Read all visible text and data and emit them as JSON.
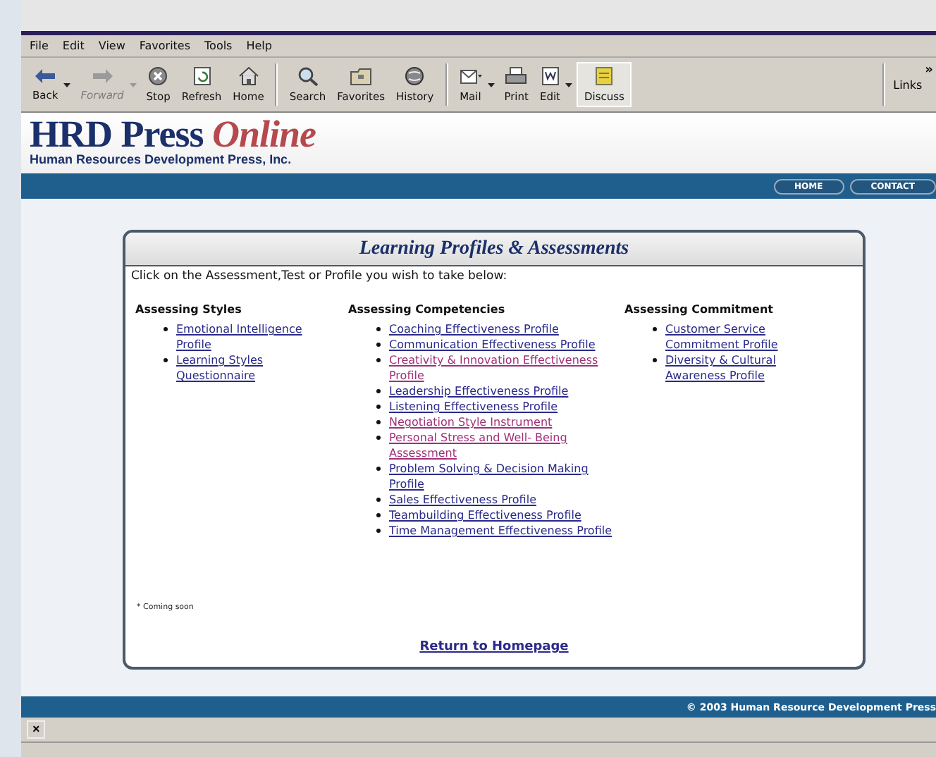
{
  "browser": {
    "menu": [
      "File",
      "Edit",
      "View",
      "Favorites",
      "Tools",
      "Help"
    ],
    "toolbar": [
      {
        "label": "Back",
        "kind": "back",
        "disabled": false,
        "dropdown": true
      },
      {
        "label": "Forward",
        "kind": "forward",
        "disabled": true,
        "dropdown": true
      },
      {
        "label": "Stop",
        "kind": "stop",
        "disabled": false,
        "dropdown": false
      },
      {
        "label": "Refresh",
        "kind": "refresh",
        "disabled": false,
        "dropdown": false
      },
      {
        "label": "Home",
        "kind": "home",
        "disabled": false,
        "dropdown": false
      },
      {
        "label": "Search",
        "kind": "search",
        "disabled": false,
        "dropdown": false
      },
      {
        "label": "Favorites",
        "kind": "folder",
        "disabled": false,
        "dropdown": false
      },
      {
        "label": "History",
        "kind": "history",
        "disabled": false,
        "dropdown": false
      },
      {
        "label": "Mail",
        "kind": "mail",
        "disabled": false,
        "dropdown": true
      },
      {
        "label": "Print",
        "kind": "print",
        "disabled": false,
        "dropdown": false
      },
      {
        "label": "Edit",
        "kind": "edit",
        "disabled": false,
        "dropdown": true
      },
      {
        "label": "Discuss",
        "kind": "discuss",
        "disabled": false,
        "dropdown": false
      }
    ],
    "links": "Links",
    "chevron": "»",
    "close": "×"
  },
  "site": {
    "logo_main": "HRD Press",
    "logo_accent": "Online",
    "tagline": "Human Resources Development Press, Inc.",
    "nav": [
      "HOME",
      "CONTACT"
    ]
  },
  "panel": {
    "title": "Learning Profiles & Assessments",
    "instruction": "Click on the Assessment,Test or Profile you wish to take below:",
    "columns": [
      {
        "heading": "Assessing Styles",
        "links": [
          {
            "text": "Emotional Intelligence Profile",
            "visited": false
          },
          {
            "text": "Learning Styles Questionnaire",
            "visited": false
          }
        ]
      },
      {
        "heading": "Assessing Competencies",
        "links": [
          {
            "text": "Coaching Effectiveness Profile",
            "visited": false
          },
          {
            "text": "Communication Effectiveness Profile",
            "visited": false
          },
          {
            "text": "Creativity & Innovation Effectiveness Profile",
            "visited": true
          },
          {
            "text": "Leadership Effectiveness Profile",
            "visited": false
          },
          {
            "text": "Listening Effectiveness Profile",
            "visited": false
          },
          {
            "text": "Negotiation Style Instrument",
            "visited": true
          },
          {
            "text": "Personal Stress and Well- Being Assessment",
            "visited": true
          },
          {
            "text": "Problem Solving & Decision Making Profile",
            "visited": false
          },
          {
            "text": "Sales Effectiveness Profile",
            "visited": false
          },
          {
            "text": "Teambuilding Effectiveness Profile",
            "visited": false
          },
          {
            "text": "Time Management Effectiveness Profile",
            "visited": false
          }
        ]
      },
      {
        "heading": "Assessing Commitment",
        "links": [
          {
            "text": "Customer Service Commitment Profile",
            "visited": false
          },
          {
            "text": "Diversity & Cultural Awareness Profile",
            "visited": false
          }
        ]
      }
    ],
    "note": "* Coming soon",
    "return_link": "Return to Homepage"
  },
  "footer": "© 2003 Human Resource Development Press"
}
